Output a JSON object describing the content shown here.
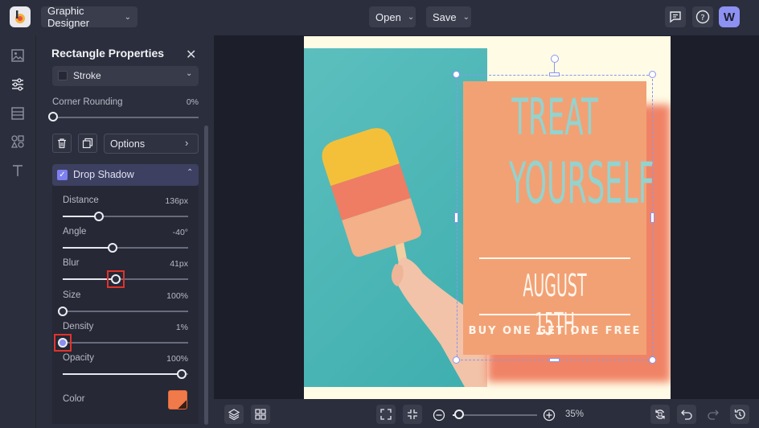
{
  "topbar": {
    "workspace_label": "Graphic Designer",
    "open_label": "Open",
    "save_label": "Save",
    "avatar_letter": "W"
  },
  "panel": {
    "title": "Rectangle Properties",
    "stroke_label": "Stroke",
    "corner_rounding": {
      "label": "Corner Rounding",
      "value": "0%",
      "level": 0
    },
    "options_label": "Options",
    "drop_shadow": {
      "label": "Drop Shadow",
      "enabled": true
    },
    "sliders": [
      {
        "label": "Distance",
        "value": "136px",
        "level": 0.29
      },
      {
        "label": "Angle",
        "value": "-40°",
        "level": 0.4
      },
      {
        "label": "Blur",
        "value": "41px",
        "level": 0.42
      },
      {
        "label": "Size",
        "value": "100%",
        "level": 0.0
      },
      {
        "label": "Density",
        "value": "1%",
        "level": 0.0
      },
      {
        "label": "Opacity",
        "value": "100%",
        "level": 0.95
      }
    ],
    "color_label": "Color",
    "shadow_color": "#f07a4a"
  },
  "design": {
    "headline_1": "TREAT",
    "headline_2": "YOURSELF",
    "date": "AUGUST 15TH",
    "offer": "BUY ONE GET ONE FREE"
  },
  "bottombar": {
    "zoom_value": "35%",
    "zoom_level": 0.08
  },
  "colors": {
    "accent": "#7c80f0",
    "highlight": "#e2332a",
    "card": "#f2a175",
    "teal": "#4db8b7"
  }
}
